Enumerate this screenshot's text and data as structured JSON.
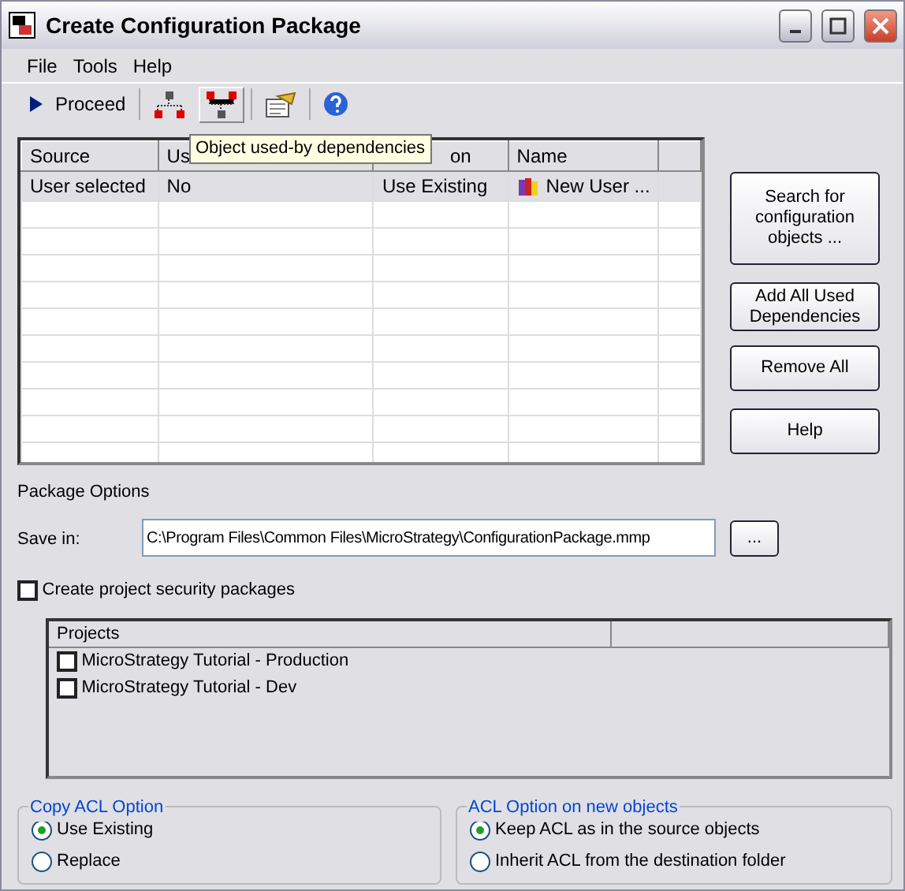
{
  "window": {
    "title": "Create Configuration Package"
  },
  "menu": [
    "File",
    "Tools",
    "Help"
  ],
  "toolbar": {
    "proceed": "Proceed",
    "tooltip": "Object used-by dependencies"
  },
  "table": {
    "columns": [
      "Source",
      "Us",
      "on",
      "Name",
      ""
    ],
    "rows": [
      {
        "cells": [
          "User selected",
          "No",
          "Use Existing",
          "New User ..."
        ],
        "selected": true
      }
    ]
  },
  "side_buttons": [
    "Search for configuration objects ...",
    "Add All Used Dependencies",
    "Remove All",
    "Help"
  ],
  "package_options": {
    "heading": "Package Options",
    "save_label": "Save in:",
    "path": "C:\\Program Files\\Common Files\\MicroStrategy\\ConfigurationPackage.mmp",
    "browse": "..."
  },
  "security": {
    "label": "Create project security packages",
    "checked": false
  },
  "projects": {
    "column": "Projects",
    "items": [
      {
        "label": "MicroStrategy Tutorial - Production",
        "checked": false
      },
      {
        "label": "MicroStrategy Tutorial - Dev",
        "checked": false
      }
    ]
  },
  "groups": [
    {
      "title": "Copy ACL Option",
      "options": [
        {
          "label": "Use Existing",
          "selected": true
        },
        {
          "label": "Replace",
          "selected": false
        }
      ]
    },
    {
      "title": "ACL Option on new objects",
      "options": [
        {
          "label": "Keep ACL as in the source objects",
          "selected": true
        },
        {
          "label": "Inherit ACL from the destination folder",
          "selected": false
        }
      ]
    }
  ]
}
